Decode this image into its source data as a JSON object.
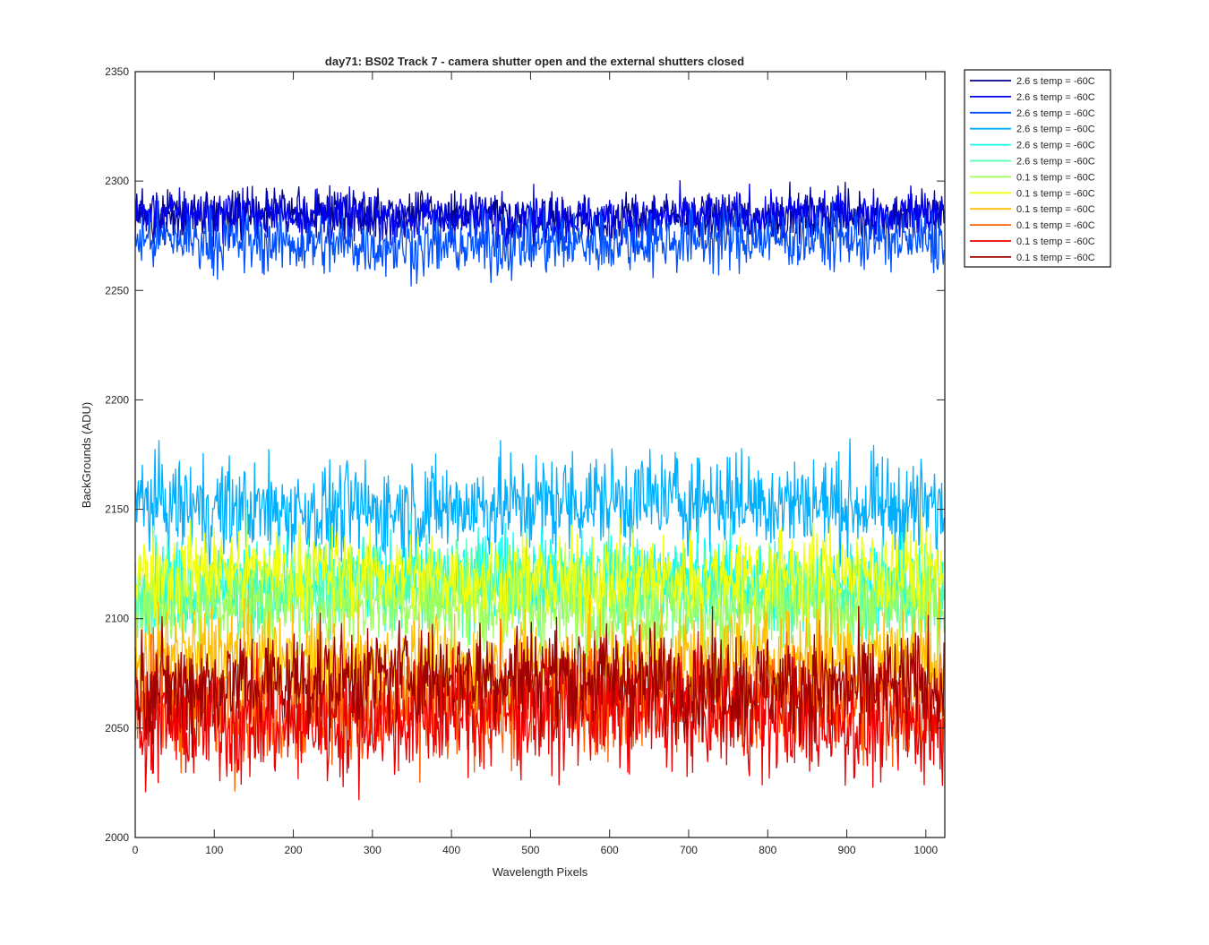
{
  "chart_data": {
    "type": "line",
    "title": "day71: BS02  Track 7 - camera shutter open and the external shutters closed",
    "xlabel": "Wavelength Pixels",
    "ylabel": "BackGrounds (ADU)",
    "xlim": [
      0,
      1024
    ],
    "ylim": [
      2000,
      2350
    ],
    "xticks": [
      0,
      100,
      200,
      300,
      400,
      500,
      600,
      700,
      800,
      900,
      1000
    ],
    "yticks": [
      2000,
      2050,
      2100,
      2150,
      2200,
      2250,
      2300,
      2350
    ],
    "grid": false,
    "legend_position": "outside-top-right",
    "x_points": 1024,
    "series": [
      {
        "name": "2.6 s temp = -60C",
        "color": "#00008f",
        "mean": 2284,
        "noise": 5.5
      },
      {
        "name": "2.6 s temp = -60C",
        "color": "#0000ef",
        "mean": 2284,
        "noise": 5.5
      },
      {
        "name": "2.6 s temp = -60C",
        "color": "#0050ff",
        "mean": 2272,
        "noise": 7.0
      },
      {
        "name": "2.6 s temp = -60C",
        "color": "#00afff",
        "mean": 2152,
        "noise": 11.0
      },
      {
        "name": "2.6 s temp = -60C",
        "color": "#0fffef",
        "mean": 2118,
        "noise": 10.0
      },
      {
        "name": "2.6 s temp = -60C",
        "color": "#50ffaf",
        "mean": 2112,
        "noise": 10.0
      },
      {
        "name": "0.1 s temp = -60C",
        "color": "#9fff5f",
        "mean": 2106,
        "noise": 10.0
      },
      {
        "name": "0.1 s temp = -60C",
        "color": "#efff0f",
        "mean": 2120,
        "noise": 10.0
      },
      {
        "name": "0.1 s temp = -60C",
        "color": "#ffbf00",
        "mean": 2080,
        "noise": 12.0
      },
      {
        "name": "0.1 s temp = -60C",
        "color": "#ff6000",
        "mean": 2062,
        "noise": 13.0
      },
      {
        "name": "0.1 s temp = -60C",
        "color": "#ef0000",
        "mean": 2055,
        "noise": 13.0
      },
      {
        "name": "0.1 s temp = -60C",
        "color": "#9f0000",
        "mean": 2072,
        "noise": 12.0
      }
    ]
  }
}
